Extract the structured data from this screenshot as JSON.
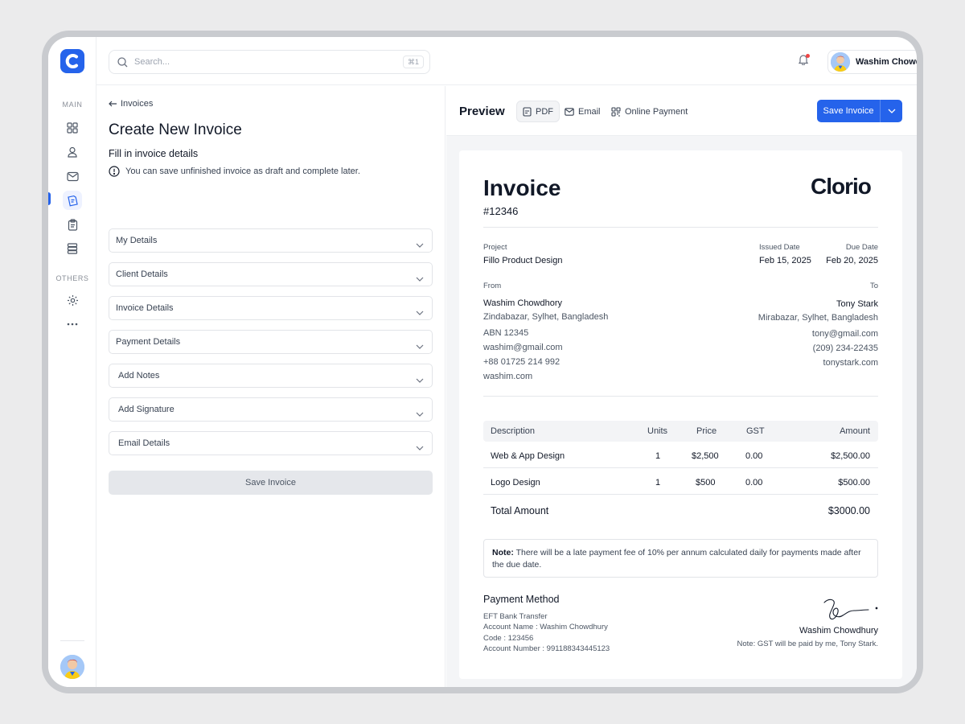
{
  "sidebar": {
    "section_main": "MAIN",
    "section_others": "OTHERS",
    "icons": [
      "dashboard-icon",
      "user-icon",
      "mail-icon",
      "invoice-icon",
      "clipboard-icon",
      "database-icon",
      "settings-icon",
      "more-icon"
    ]
  },
  "topbar": {
    "search_placeholder": "Search...",
    "search_shortcut": "⌘1",
    "user_name": "Washim Chowdhury"
  },
  "form": {
    "back_label": "Invoices",
    "title": "Create New Invoice",
    "subtitle": "Fill in invoice details",
    "info": "You can save unfinished invoice as draft and complete later.",
    "sections": [
      "My Details",
      "Client Details",
      "Invoice Details",
      "Payment Details",
      "Add Notes",
      "Add Signature",
      "Email Details"
    ],
    "save_label": "Save Invoice"
  },
  "preview": {
    "title": "Preview",
    "tabs": [
      "PDF",
      "Email",
      "Online Payment"
    ],
    "save_label": "Save Invoice"
  },
  "invoice": {
    "title": "Invoice",
    "number": "#12346",
    "brand": "Clorio",
    "project_label": "Project",
    "project": "Fillo Product Design",
    "issued_label": "Issued Date",
    "issued": "Feb 15, 2025",
    "due_label": "Due Date",
    "due": "Feb 20, 2025",
    "from_label": "From",
    "from": {
      "name": "Washim Chowdhory",
      "address": "Zindabazar, Sylhet, Bangladesh",
      "abn": "ABN 12345",
      "email": "washim@gmail.com",
      "phone": "+88 01725 214 992",
      "web": "washim.com"
    },
    "to_label": "To",
    "to": {
      "name": "Tony Stark",
      "address": "Mirabazar, Sylhet, Bangladesh",
      "email": "tony@gmail.com",
      "phone": "(209) 234-22435",
      "web": "tonystark.com"
    },
    "table": {
      "headers": [
        "Description",
        "Units",
        "Price",
        "GST",
        "Amount"
      ],
      "rows": [
        [
          "Web & App Design",
          "1",
          "$2,500",
          "0.00",
          "$2,500.00"
        ],
        [
          "Logo Design",
          "1",
          "$500",
          "0.00",
          "$500.00"
        ]
      ],
      "total_label": "Total Amount",
      "total": "$3000.00"
    },
    "note_label": "Note:",
    "note": "There will be a late payment fee of 10% per annum calculated daily for payments made after the due date.",
    "payment_title": "Payment Method",
    "payment_lines": [
      "EFT Bank Transfer",
      "Account Name : Washim Chowdhury",
      "Code : 123456",
      "Account Number : 991188343445123"
    ],
    "signer": "Washim Chowdhury",
    "gst_note": "Note: GST will be paid by me, Tony Stark."
  },
  "colors": {
    "accent": "#2563eb",
    "background": "#ebebec",
    "frame": "#c9cbcf"
  }
}
